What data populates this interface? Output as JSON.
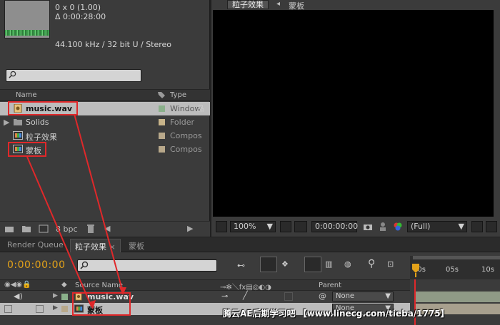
{
  "project": {
    "info_lines": [
      "0 x 0 (1.00)",
      "Δ 0:00:28:00",
      "44.100 kHz / 32 bit U / Stereo"
    ],
    "columns": {
      "name": "Name",
      "type": "Type"
    },
    "items": [
      {
        "name": "music.wav",
        "type": "Window",
        "swatch": "#8ab08a",
        "icon": "audio-file-icon",
        "selected": true
      },
      {
        "name": "Solids",
        "type": "Folder",
        "swatch": "#c8b48a",
        "icon": "folder-icon",
        "selected": false
      },
      {
        "name": "粒子效果",
        "type": "Compos",
        "swatch": "#b8a88a",
        "icon": "composition-icon",
        "selected": false
      },
      {
        "name": "蒙板",
        "type": "Compos",
        "swatch": "#b8a88a",
        "icon": "composition-icon",
        "selected": false
      }
    ],
    "bpc": "8 bpc"
  },
  "viewer": {
    "tab": "粒子效果",
    "breadcrumb": "蒙板",
    "zoom": "100%",
    "timecode": "0:00:00:00",
    "resolution": "(Full)"
  },
  "timeline": {
    "tabs": [
      "Render Queue",
      "粒子效果",
      "蒙板"
    ],
    "current_time": "0:00:00:00",
    "ruler_labels": [
      "00s",
      "05s",
      "10s"
    ],
    "headers": {
      "source": "Source Name",
      "parent": "Parent"
    },
    "layers": [
      {
        "name": "music.wav",
        "parent": "None",
        "color": "#8ab08a",
        "icon": "audio-file-icon"
      },
      {
        "name": "蒙板",
        "parent": "None",
        "color": "#b8a88a",
        "icon": "composition-icon"
      }
    ]
  },
  "watermark": "腾云AE后期学习吧 【www.linecg.com/tieba/1775】",
  "colors": {
    "accent_timecode": "#e3a21a",
    "annotation": "#e0282a"
  }
}
